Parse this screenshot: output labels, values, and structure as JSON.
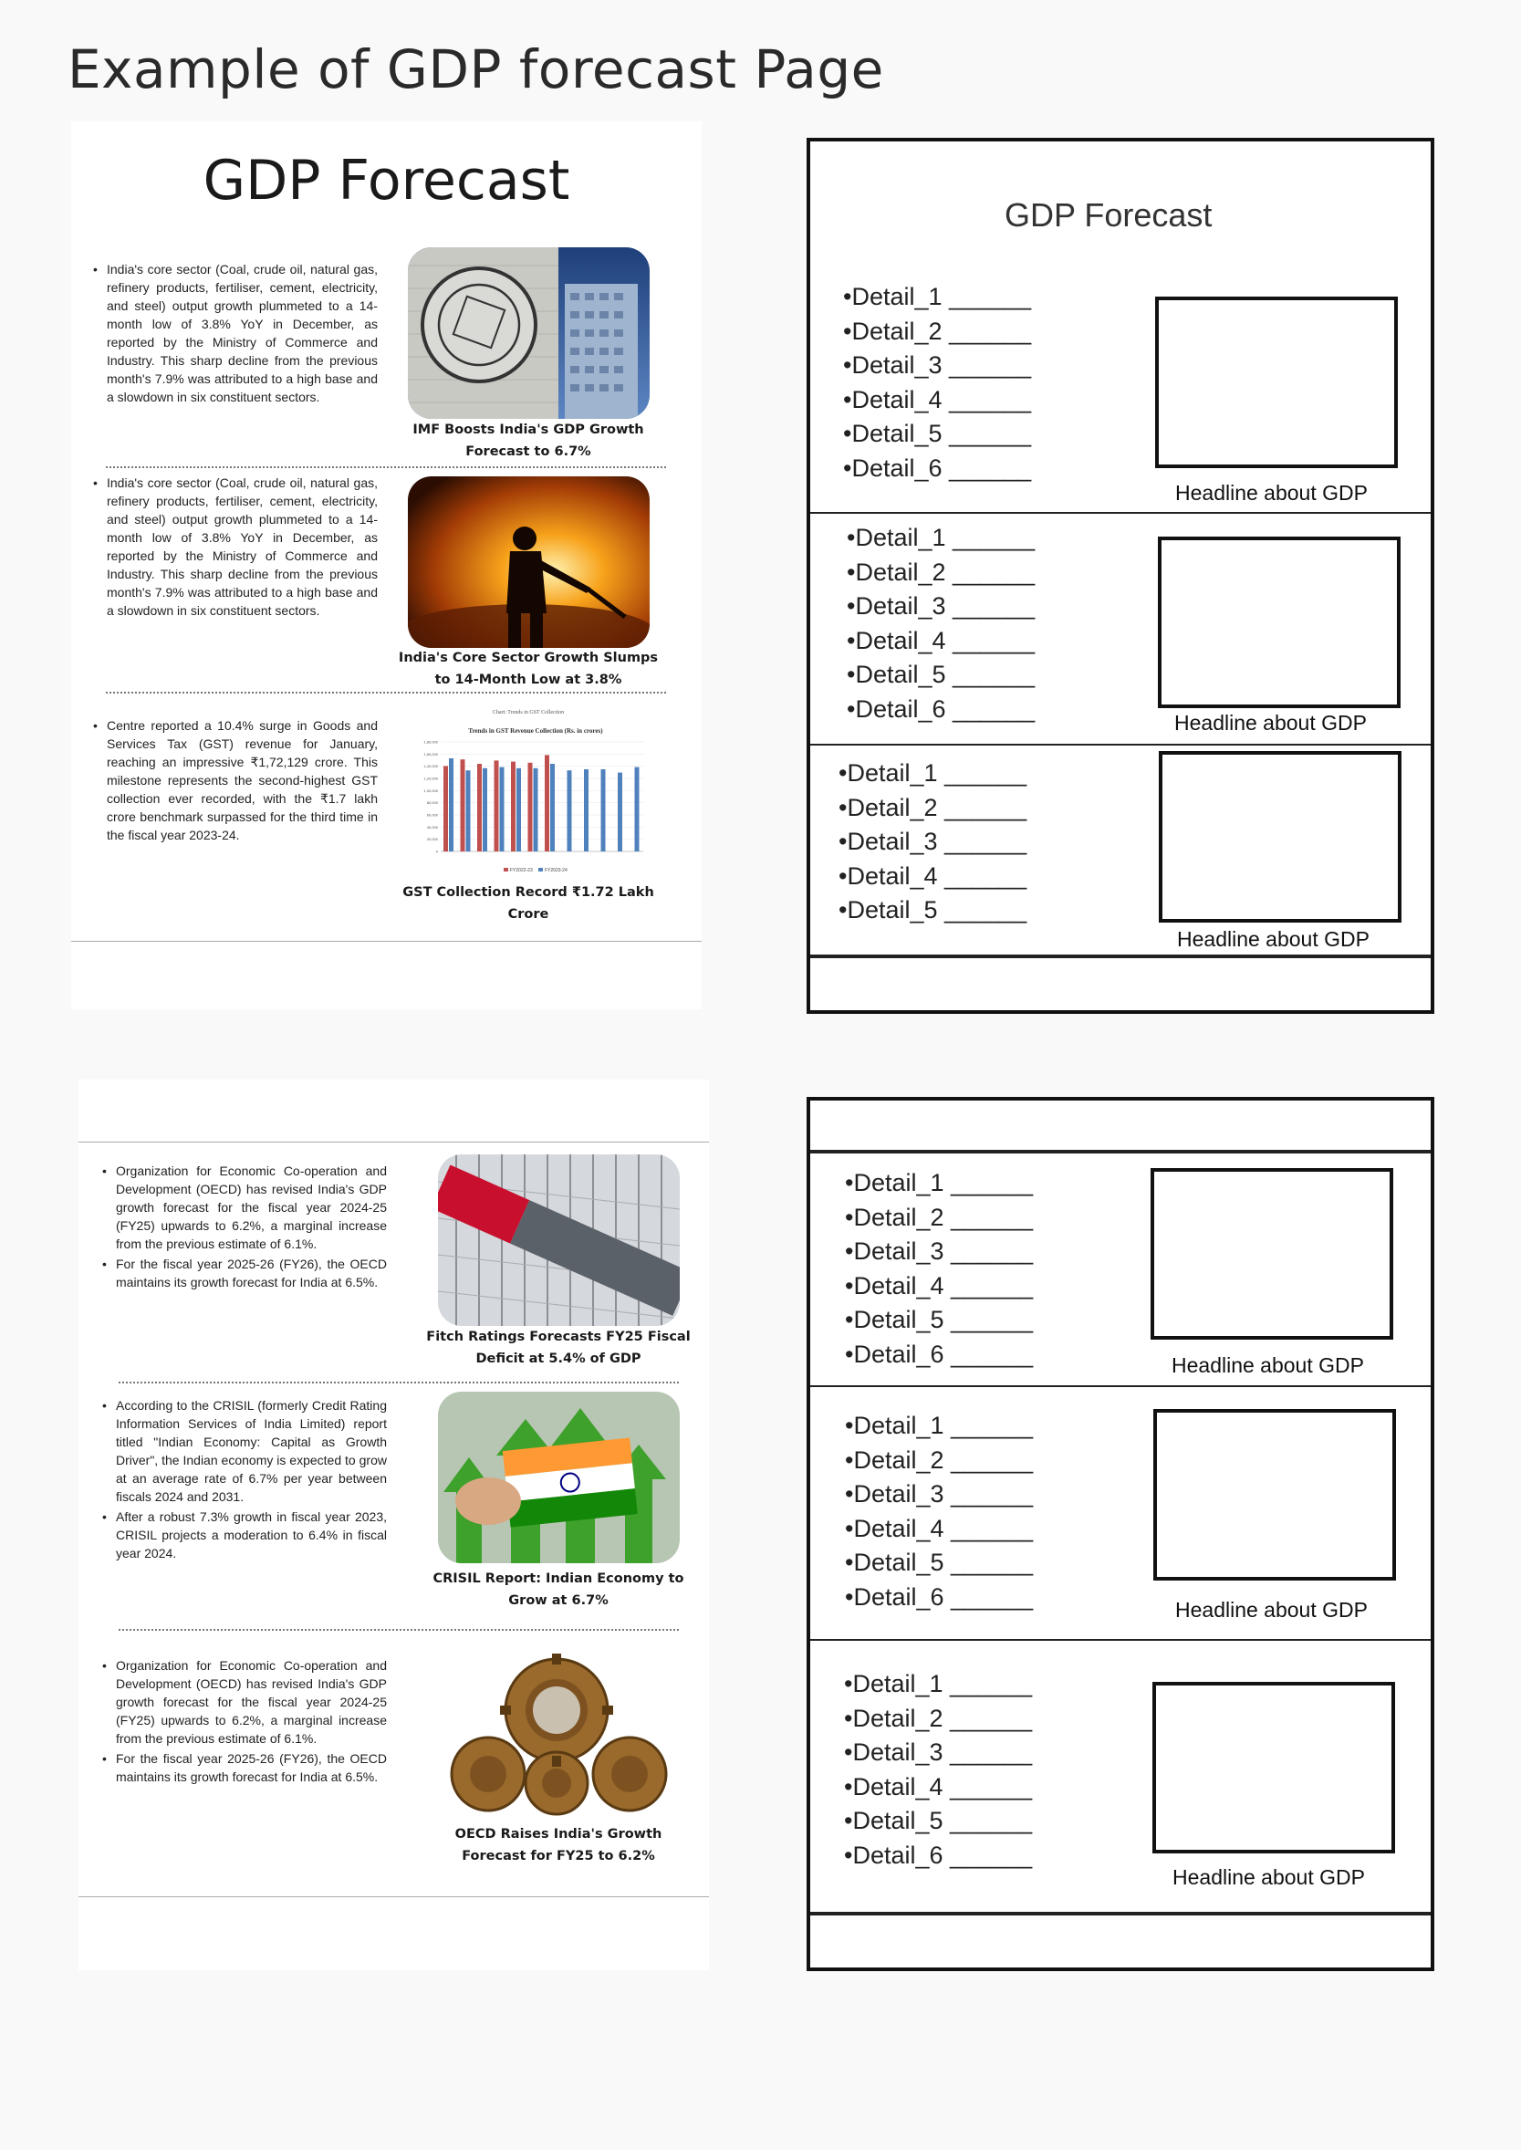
{
  "main_title": "Example of GDP forecast Page",
  "page1": {
    "title": "GDP Forecast",
    "articles": [
      {
        "bullets": [
          "India's core sector (Coal, crude oil, natural gas, refinery products, fertiliser, cement, electricity, and steel) output growth plummeted to a 14-month low of 3.8% YoY in December, as reported by the Ministry of Commerce and Industry. This sharp decline from the previous month's 7.9% was attributed to a high base and a slowdown in six constituent sectors."
        ],
        "image": "imf-building-photo",
        "caption": "IMF Boosts India's GDP Growth Forecast to 6.7%"
      },
      {
        "bullets": [
          "India's core sector (Coal, crude oil, natural gas, refinery products, fertiliser, cement, electricity, and steel) output growth plummeted to a 14-month low of 3.8% YoY in December, as reported by the Ministry of Commerce and Industry. This sharp decline from the previous month's 7.9% was attributed to a high base and a slowdown in six constituent sectors."
        ],
        "image": "steel-worker-photo",
        "caption": "India's Core Sector Growth Slumps to 14-Month Low at 3.8%"
      },
      {
        "bullets": [
          "Centre reported a 10.4% surge in Goods and Services Tax (GST) revenue for January, reaching an impressive ₹1,72,129 crore. This milestone represents the second-highest GST collection ever recorded, with the ₹1.7 lakh crore benchmark surpassed for the third time in the fiscal year 2023-24."
        ],
        "image": "gst-bar-chart",
        "caption": "GST Collection Record ₹1.72 Lakh Crore"
      }
    ]
  },
  "page2": {
    "articles": [
      {
        "bullets": [
          "Organization for Economic Co-operation and Development (OECD) has revised India's GDP growth forecast for the fiscal year 2024-25 (FY25) upwards to 6.2%, a marginal increase from the previous estimate of 6.1%.",
          "For the fiscal year 2025-26 (FY26), the OECD maintains its growth forecast for India at 6.5%."
        ],
        "image": "fitch-ratings-building-photo",
        "caption": "Fitch Ratings Forecasts FY25 Fiscal Deficit at 5.4% of GDP"
      },
      {
        "bullets": [
          "According to the CRISIL (formerly Credit Rating Information Services of India Limited) report titled \"Indian Economy: Capital as Growth Driver\", the Indian economy is expected to grow at an average rate of 6.7% per year between fiscals 2024 and 2031.",
          "After a robust 7.3% growth in fiscal year 2023, CRISIL projects a moderation to 6.4% in fiscal year 2024."
        ],
        "image": "india-flag-arrows-photo",
        "caption": "CRISIL Report: Indian Economy to Grow at 6.7%"
      },
      {
        "bullets": [
          "Organization for Economic Co-operation and Development (OECD) has revised India's GDP growth forecast for the fiscal year 2024-25 (FY25) upwards to 6.2%, a marginal increase from the previous estimate of 6.1%.",
          "For the fiscal year 2025-26 (FY26), the OECD maintains its growth forecast for India at 6.5%."
        ],
        "image": "rupee-gears-photo",
        "caption": "OECD Raises India's Growth Forecast for FY25 to 6.2%"
      }
    ]
  },
  "wireframe1": {
    "title": "GDP Forecast",
    "sections": [
      {
        "details": [
          "•Detail_1 ______",
          "•Detail_2 ______",
          "•Detail_3 ______",
          "•Detail_4 ______",
          "•Detail_5 ______",
          "•Detail_6 ______"
        ],
        "headline": "Headline about GDP"
      },
      {
        "details": [
          "•Detail_1 ______",
          "•Detail_2 ______",
          "•Detail_3 ______",
          "•Detail_4 ______",
          "•Detail_5 ______",
          "•Detail_6 ______"
        ],
        "headline": "Headline about GDP"
      },
      {
        "details": [
          "•Detail_1 ______",
          "•Detail_2 ______",
          "•Detail_3 ______",
          "•Detail_4 ______",
          "•Detail_5 ______"
        ],
        "headline": "Headline about GDP"
      }
    ]
  },
  "wireframe2": {
    "sections": [
      {
        "details": [
          "•Detail_1 ______",
          "•Detail_2 ______",
          "•Detail_3 ______",
          "•Detail_4 ______",
          "•Detail_5 ______",
          "•Detail_6 ______"
        ],
        "headline": "Headline about GDP"
      },
      {
        "details": [
          "•Detail_1 ______",
          "•Detail_2 ______",
          "•Detail_3 ______",
          "•Detail_4 ______",
          "•Detail_5 ______",
          "•Detail_6 ______"
        ],
        "headline": "Headline about GDP"
      },
      {
        "details": [
          "•Detail_1 ______",
          "•Detail_2 ______",
          "•Detail_3 ______",
          "•Detail_4 ______",
          "•Detail_5 ______",
          "•Detail_6 ______"
        ],
        "headline": "Headline about GDP"
      }
    ]
  },
  "gst_chart": {
    "title": "Chart: Trends in GST Collection",
    "subtitle": "Trends in GST Revenue Collection (Rs. in crores)",
    "y_ticks": [
      "1,80,000",
      "1,60,000",
      "1,40,000",
      "1,20,000",
      "1,00,000",
      "80,000",
      "60,000",
      "40,000",
      "20,000",
      "0"
    ],
    "legend": [
      "FY2022-23",
      "FY2023-24"
    ],
    "colors": {
      "fy2223": "#c0504d",
      "fy2324": "#4f81bd"
    }
  },
  "colors": {
    "wire_border": "#111111",
    "page_bg": "#ffffff",
    "canvas_bg": "#f9f9f9"
  }
}
